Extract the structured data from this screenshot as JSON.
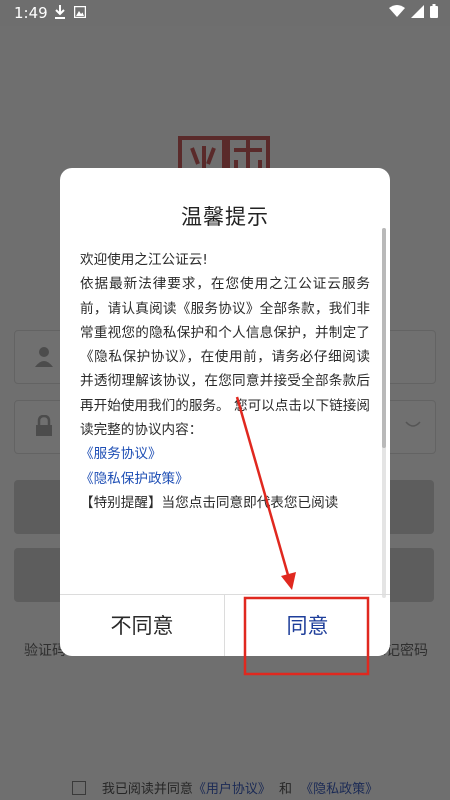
{
  "status_bar": {
    "time": "1:49",
    "icons": [
      "download-icon",
      "photo-icon",
      "wifi-icon",
      "signal-icon",
      "battery-icon"
    ]
  },
  "background": {
    "code_login_link": "验证码",
    "forgot_password_link": "忘记密码",
    "agreement": {
      "prefix": "我已阅读并同意",
      "user_agreement": "《用户协议》",
      "and": "和",
      "privacy_policy": "《隐私政策》"
    }
  },
  "dialog": {
    "title": "温馨提示",
    "greeting": "欢迎使用之江公证云!",
    "paragraph": "依据最新法律要求，在您使用之江公证云服务前，请认真阅读《服务协议》全部条款，我们非常重视您的隐私保护和个人信息保护，并制定了《隐私保护协议》，在使用前，请务必仔细阅读并透彻理解该协议，在您同意并接受全部条款后再开始使用我们的服务。 您可以点击以下链接阅读完整的协议内容：",
    "link_service": "《服务协议》",
    "link_privacy": "《隐私保护政策》",
    "notice": "【特别提醒】当您点击同意即代表您已阅读",
    "disagree_label": "不同意",
    "agree_label": "同意"
  },
  "colors": {
    "link": "#1f4fb5",
    "agree_text": "#1e3e9a",
    "annotation": "#e0281f"
  }
}
